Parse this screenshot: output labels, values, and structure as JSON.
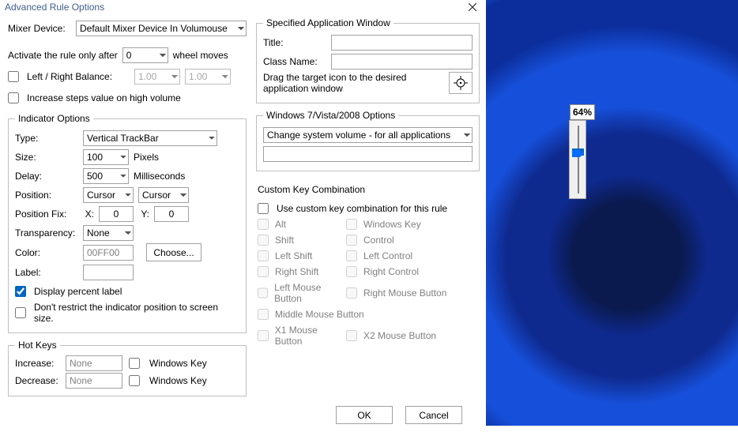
{
  "window": {
    "title": "Advanced Rule Options"
  },
  "mixer": {
    "label": "Mixer Device:",
    "value": "Default Mixer Device In Volumouse"
  },
  "activate": {
    "label_before": "Activate the rule only after",
    "value": "0",
    "label_after": "wheel moves"
  },
  "lrbalance": {
    "label": "Left / Right Balance:",
    "left": "1.00",
    "right": "1.00"
  },
  "increase_high": {
    "label": "Increase steps value on high volume"
  },
  "indicator": {
    "legend": "Indicator Options",
    "type_label": "Type:",
    "type_value": "Vertical TrackBar",
    "size_label": "Size:",
    "size_value": "100",
    "size_unit": "Pixels",
    "delay_label": "Delay:",
    "delay_value": "500",
    "delay_unit": "Milliseconds",
    "position_label": "Position:",
    "pos_x_sel": "Cursor",
    "pos_y_sel": "Cursor",
    "posfix_label": "Position Fix:",
    "posfix_x_label": "X:",
    "posfix_x": "0",
    "posfix_y_label": "Y:",
    "posfix_y": "0",
    "transparency_label": "Transparency:",
    "transparency_value": "None",
    "color_label": "Color:",
    "color_value": "00FF00",
    "choose": "Choose...",
    "label_label": "Label:",
    "label_value": "",
    "display_percent": "Display percent label",
    "dont_restrict": "Don't restrict the indicator position to screen size."
  },
  "hotkeys": {
    "legend": "Hot Keys",
    "increase_label": "Increase:",
    "decrease_label": "Decrease:",
    "none": "None",
    "winkey": "Windows Key"
  },
  "appwin": {
    "legend": "Specified Application Window",
    "title_label": "Title:",
    "class_label": "Class Name:",
    "drag_text": "Drag the target icon to the desired application window"
  },
  "win7": {
    "legend": "Windows 7/Vista/2008 Options",
    "value": "Change system volume - for all applications"
  },
  "custom": {
    "legend": "Custom Key Combination",
    "use_label": "Use custom key combination for this rule",
    "keys": {
      "alt": "Alt",
      "winkey": "Windows Key",
      "shift": "Shift",
      "control": "Control",
      "lshift": "Left Shift",
      "lcontrol": "Left Control",
      "rshift": "Right Shift",
      "rcontrol": "Right Control",
      "lmb": "Left Mouse Button",
      "rmb": "Right Mouse Button",
      "mmb": "Middle Mouse Button",
      "x1": "X1 Mouse Button",
      "x2": "X2 Mouse Button"
    }
  },
  "buttons": {
    "ok": "OK",
    "cancel": "Cancel"
  },
  "overlay": {
    "percent": "64%",
    "value_pct": 36
  }
}
